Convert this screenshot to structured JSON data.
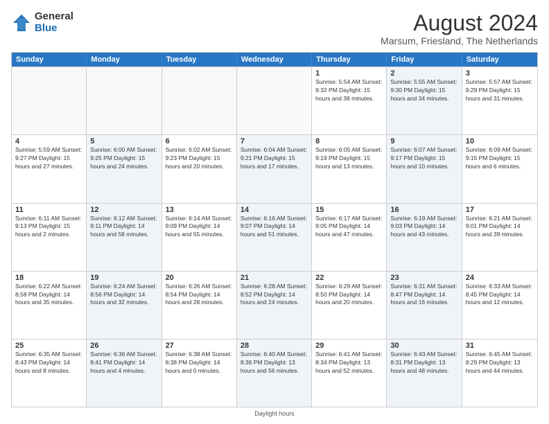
{
  "logo": {
    "general": "General",
    "blue": "Blue"
  },
  "title": "August 2024",
  "subtitle": "Marsum, Friesland, The Netherlands",
  "days_of_week": [
    "Sunday",
    "Monday",
    "Tuesday",
    "Wednesday",
    "Thursday",
    "Friday",
    "Saturday"
  ],
  "footer": "Daylight hours",
  "weeks": [
    [
      {
        "date": "",
        "info": "",
        "shaded": false
      },
      {
        "date": "",
        "info": "",
        "shaded": false
      },
      {
        "date": "",
        "info": "",
        "shaded": false
      },
      {
        "date": "",
        "info": "",
        "shaded": false
      },
      {
        "date": "1",
        "info": "Sunrise: 5:54 AM\nSunset: 9:32 PM\nDaylight: 15 hours\nand 38 minutes.",
        "shaded": false
      },
      {
        "date": "2",
        "info": "Sunrise: 5:55 AM\nSunset: 9:30 PM\nDaylight: 15 hours\nand 34 minutes.",
        "shaded": true
      },
      {
        "date": "3",
        "info": "Sunrise: 5:57 AM\nSunset: 9:29 PM\nDaylight: 15 hours\nand 31 minutes.",
        "shaded": false
      }
    ],
    [
      {
        "date": "4",
        "info": "Sunrise: 5:59 AM\nSunset: 9:27 PM\nDaylight: 15 hours\nand 27 minutes.",
        "shaded": false
      },
      {
        "date": "5",
        "info": "Sunrise: 6:00 AM\nSunset: 9:25 PM\nDaylight: 15 hours\nand 24 minutes.",
        "shaded": true
      },
      {
        "date": "6",
        "info": "Sunrise: 6:02 AM\nSunset: 9:23 PM\nDaylight: 15 hours\nand 20 minutes.",
        "shaded": false
      },
      {
        "date": "7",
        "info": "Sunrise: 6:04 AM\nSunset: 9:21 PM\nDaylight: 15 hours\nand 17 minutes.",
        "shaded": true
      },
      {
        "date": "8",
        "info": "Sunrise: 6:05 AM\nSunset: 9:19 PM\nDaylight: 15 hours\nand 13 minutes.",
        "shaded": false
      },
      {
        "date": "9",
        "info": "Sunrise: 6:07 AM\nSunset: 9:17 PM\nDaylight: 15 hours\nand 10 minutes.",
        "shaded": true
      },
      {
        "date": "10",
        "info": "Sunrise: 6:09 AM\nSunset: 9:15 PM\nDaylight: 15 hours\nand 6 minutes.",
        "shaded": false
      }
    ],
    [
      {
        "date": "11",
        "info": "Sunrise: 6:11 AM\nSunset: 9:13 PM\nDaylight: 15 hours\nand 2 minutes.",
        "shaded": false
      },
      {
        "date": "12",
        "info": "Sunrise: 6:12 AM\nSunset: 9:11 PM\nDaylight: 14 hours\nand 58 minutes.",
        "shaded": true
      },
      {
        "date": "13",
        "info": "Sunrise: 6:14 AM\nSunset: 9:09 PM\nDaylight: 14 hours\nand 55 minutes.",
        "shaded": false
      },
      {
        "date": "14",
        "info": "Sunrise: 6:16 AM\nSunset: 9:07 PM\nDaylight: 14 hours\nand 51 minutes.",
        "shaded": true
      },
      {
        "date": "15",
        "info": "Sunrise: 6:17 AM\nSunset: 9:05 PM\nDaylight: 14 hours\nand 47 minutes.",
        "shaded": false
      },
      {
        "date": "16",
        "info": "Sunrise: 6:19 AM\nSunset: 9:03 PM\nDaylight: 14 hours\nand 43 minutes.",
        "shaded": true
      },
      {
        "date": "17",
        "info": "Sunrise: 6:21 AM\nSunset: 9:01 PM\nDaylight: 14 hours\nand 39 minutes.",
        "shaded": false
      }
    ],
    [
      {
        "date": "18",
        "info": "Sunrise: 6:22 AM\nSunset: 8:58 PM\nDaylight: 14 hours\nand 35 minutes.",
        "shaded": false
      },
      {
        "date": "19",
        "info": "Sunrise: 6:24 AM\nSunset: 8:56 PM\nDaylight: 14 hours\nand 32 minutes.",
        "shaded": true
      },
      {
        "date": "20",
        "info": "Sunrise: 6:26 AM\nSunset: 8:54 PM\nDaylight: 14 hours\nand 28 minutes.",
        "shaded": false
      },
      {
        "date": "21",
        "info": "Sunrise: 6:28 AM\nSunset: 8:52 PM\nDaylight: 14 hours\nand 24 minutes.",
        "shaded": true
      },
      {
        "date": "22",
        "info": "Sunrise: 6:29 AM\nSunset: 8:50 PM\nDaylight: 14 hours\nand 20 minutes.",
        "shaded": false
      },
      {
        "date": "23",
        "info": "Sunrise: 6:31 AM\nSunset: 8:47 PM\nDaylight: 14 hours\nand 16 minutes.",
        "shaded": true
      },
      {
        "date": "24",
        "info": "Sunrise: 6:33 AM\nSunset: 8:45 PM\nDaylight: 14 hours\nand 12 minutes.",
        "shaded": false
      }
    ],
    [
      {
        "date": "25",
        "info": "Sunrise: 6:35 AM\nSunset: 8:43 PM\nDaylight: 14 hours\nand 8 minutes.",
        "shaded": false
      },
      {
        "date": "26",
        "info": "Sunrise: 6:36 AM\nSunset: 8:41 PM\nDaylight: 14 hours\nand 4 minutes.",
        "shaded": true
      },
      {
        "date": "27",
        "info": "Sunrise: 6:38 AM\nSunset: 8:38 PM\nDaylight: 14 hours\nand 0 minutes.",
        "shaded": false
      },
      {
        "date": "28",
        "info": "Sunrise: 6:40 AM\nSunset: 8:36 PM\nDaylight: 13 hours\nand 56 minutes.",
        "shaded": true
      },
      {
        "date": "29",
        "info": "Sunrise: 6:41 AM\nSunset: 8:34 PM\nDaylight: 13 hours\nand 52 minutes.",
        "shaded": false
      },
      {
        "date": "30",
        "info": "Sunrise: 6:43 AM\nSunset: 8:31 PM\nDaylight: 13 hours\nand 48 minutes.",
        "shaded": true
      },
      {
        "date": "31",
        "info": "Sunrise: 6:45 AM\nSunset: 8:29 PM\nDaylight: 13 hours\nand 44 minutes.",
        "shaded": false
      }
    ]
  ]
}
